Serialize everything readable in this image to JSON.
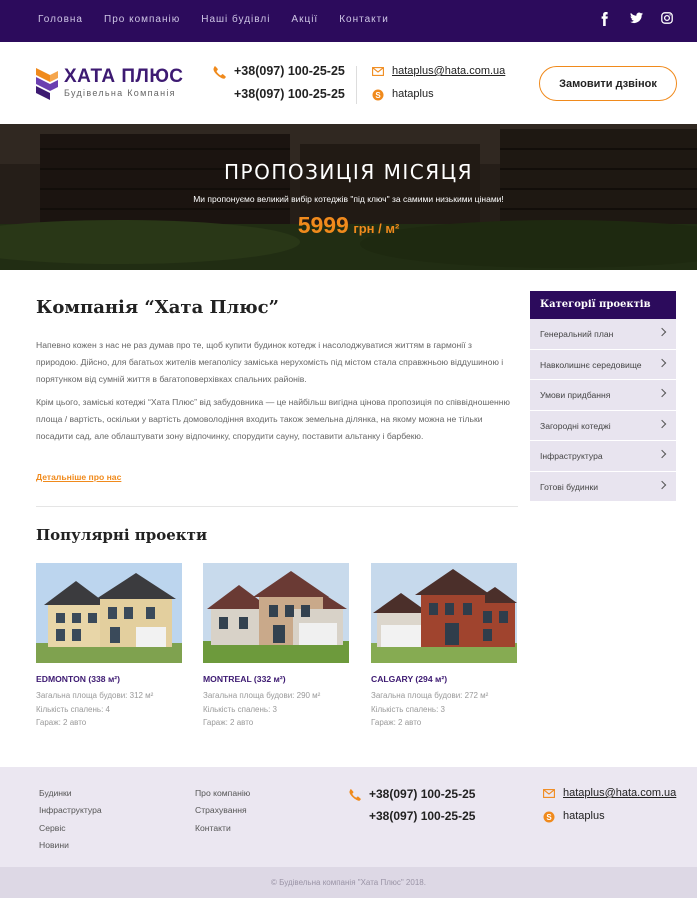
{
  "colors": {
    "brand": "#2c0b5c",
    "accent": "#f08a1c",
    "sidebar_bg": "#e8e4ef",
    "footer_bg": "#ebe7f1"
  },
  "topnav": {
    "items": [
      "Головна",
      "Про компанію",
      "Наші будівлі",
      "Акції",
      "Контакти"
    ],
    "social_icons": [
      "facebook-icon",
      "twitter-icon",
      "instagram-icon"
    ]
  },
  "header": {
    "logo_title": "ХАТА ПЛЮС",
    "logo_subtitle": "Будівельна Компанія",
    "phone1": "+38(097) 100-25-25",
    "phone2": "+38(097) 100-25-25",
    "email": "hataplus@hata.com.ua",
    "skype": "hataplus",
    "call_button": "Замовити дзвінок"
  },
  "hero": {
    "title": "ПРОПОЗИЦІЯ МІСЯЦЯ",
    "subtitle": "Ми пропонуємо великий вибір котеджів \"під ключ\" за самими низькими цінами!",
    "price": "5999",
    "price_unit": "грн / м²"
  },
  "about": {
    "title": "Компанія “Хата Плюс”",
    "paragraph1": "Напевно кожен з нас не раз думав про те, щоб купити будинок котедж і насолоджуватися життям в гармонії з природою. Дійсно, для багатьох жителів мегаполісу заміська нерухомість під містом стала справжньою віддушиною і порятунком від сумній життя в багатоповерхівках спальних районів.",
    "paragraph2": "Крім цього, заміські котеджі “Хата Плюс” від забудовника — це найбільш вигідна цінова пропозиція по співвідношенню площа / вартість, оскільки у вартість домоволодіння входить також земельна ділянка, на якому можна не тільки посадити сад, але облаштувати зону відпочинку, спорудити сауну, поставити альтанку і барбекю.",
    "more_link": "Детальніше про нас"
  },
  "popular": {
    "title": "Популярні проекти",
    "projects": [
      {
        "name": "EDMONTON (338 м²)",
        "area": "Загальна площа будови: 312 м²",
        "bedrooms": "Кількість спалень: 4",
        "garage": "Гараж: 2 авто"
      },
      {
        "name": "MONTREAL (332 м²)",
        "area": "Загальна площа будови: 290 м²",
        "bedrooms": "Кількість спалень: 3",
        "garage": "Гараж: 2 авто"
      },
      {
        "name": "CALGARY (294 м²)",
        "area": "Загальна площа будови: 272 м²",
        "bedrooms": "Кількість спалень: 3",
        "garage": "Гараж: 2 авто"
      }
    ]
  },
  "sidebar": {
    "title": "Категорії проектів",
    "items": [
      "Генеральний план",
      "Навколишнє середовище",
      "Умови придбання",
      "Загородні котеджі",
      "Інфраструктура",
      "Готові будинки"
    ]
  },
  "footer": {
    "col1": [
      "Будинки",
      "Інфраструктура",
      "Сервіс",
      "Новини"
    ],
    "col2": [
      "Про компанію",
      "Страхування",
      "Контакти"
    ],
    "phone1": "+38(097) 100-25-25",
    "phone2": "+38(097) 100-25-25",
    "email": "hataplus@hata.com.ua",
    "skype": "hataplus",
    "copyright": "© Будівельна компанія \"Хата Плюс\" 2018."
  }
}
